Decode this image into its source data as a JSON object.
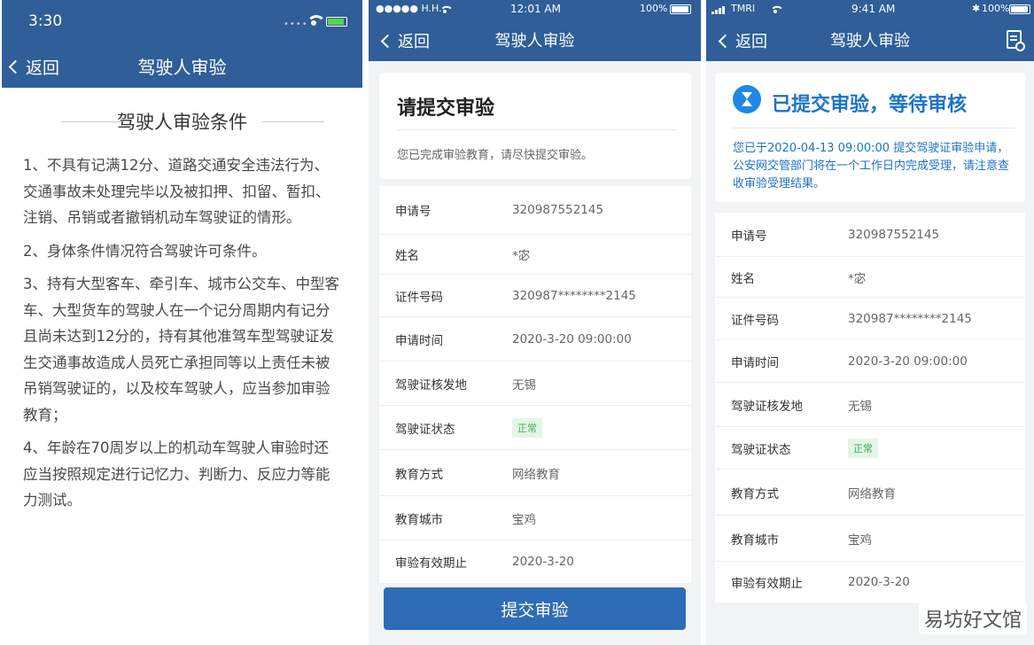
{
  "panel1": {
    "status_time": "3:30",
    "back_label": "返回",
    "title": "驾驶人审验",
    "conditions_title": "驾驶人审验条件",
    "conditions": [
      "1、不具有记满12分、道路交通安全违法行为、交通事故未处理完毕以及被扣押、扣留、暂扣、注销、吊销或者撤销机动车驾驶证的情形。",
      "2、身体条件情况符合驾驶许可条件。",
      "3、持有大型客车、牵引车、城市公交车、中型客车、大型货车的驾驶人在一个记分周期内有记分且尚未达到12分的，持有其他准驾车型驾驶证发生交通事故造成人员死亡承担同等以上责任未被吊销驾驶证的，以及校车驾驶人，应当参加审验教育；",
      "4、年龄在70周岁以上的机动车驾驶人审验时还应当按照规定进行记忆力、判断力、反应力等能力测试。"
    ]
  },
  "panel2": {
    "status_carrier": "●●●●● H.H.",
    "status_time": "12:01 AM",
    "status_battery": "100%",
    "back_label": "返回",
    "title": "驾驶人审验",
    "heading": "请提交审验",
    "subtext": "您已完成审验教育，请尽快提交审验。",
    "rows": [
      {
        "label": "申请号",
        "value": "320987552145"
      },
      {
        "label": "姓名",
        "value": "*宓"
      },
      {
        "label": "证件号码",
        "value": "320987********2145"
      },
      {
        "label": "申请时间",
        "value": "2020-3-20 09:00:00"
      },
      {
        "label": "驾驶证核发地",
        "value": "无锡"
      },
      {
        "label": "驾驶证状态",
        "value": "正常"
      },
      {
        "label": "教育方式",
        "value": "网络教育"
      },
      {
        "label": "教育城市",
        "value": "宝鸡"
      },
      {
        "label": "审验有效期止",
        "value": "2020-3-20"
      }
    ],
    "submit_label": "提交审验"
  },
  "panel3": {
    "status_carrier": "TMRI",
    "status_time": "9:41 AM",
    "status_battery": "100%",
    "back_label": "返回",
    "title": "驾驶人审验",
    "heading": "已提交审验，等待审核",
    "message": "您已于2020-04-13 09:00:00 提交驾驶证审验申请，公安网交管部门将在一个工作日内完成受理，请注意查收审验受理结果。",
    "rows": [
      {
        "label": "申请号",
        "value": "320987552145"
      },
      {
        "label": "姓名",
        "value": "*宓"
      },
      {
        "label": "证件号码",
        "value": "320987********2145"
      },
      {
        "label": "申请时间",
        "value": "2020-3-20 09:00:00"
      },
      {
        "label": "驾驶证核发地",
        "value": "无锡"
      },
      {
        "label": "驾驶证状态",
        "value": "正常"
      },
      {
        "label": "教育方式",
        "value": "网络教育"
      },
      {
        "label": "教育城市",
        "value": "宝鸡"
      },
      {
        "label": "审验有效期止",
        "value": "2020-3-20"
      }
    ]
  },
  "watermark": "易坊好文馆",
  "colors": {
    "nav_blue": "#2f5e98",
    "accent_blue": "#1e73c8",
    "button_blue": "#2f6cb7",
    "badge_green": "#3fae53"
  },
  "icons": [
    "chevron-left-icon",
    "wifi-icon",
    "battery-icon",
    "signal-icon",
    "hourglass-icon",
    "document-clock-icon"
  ]
}
